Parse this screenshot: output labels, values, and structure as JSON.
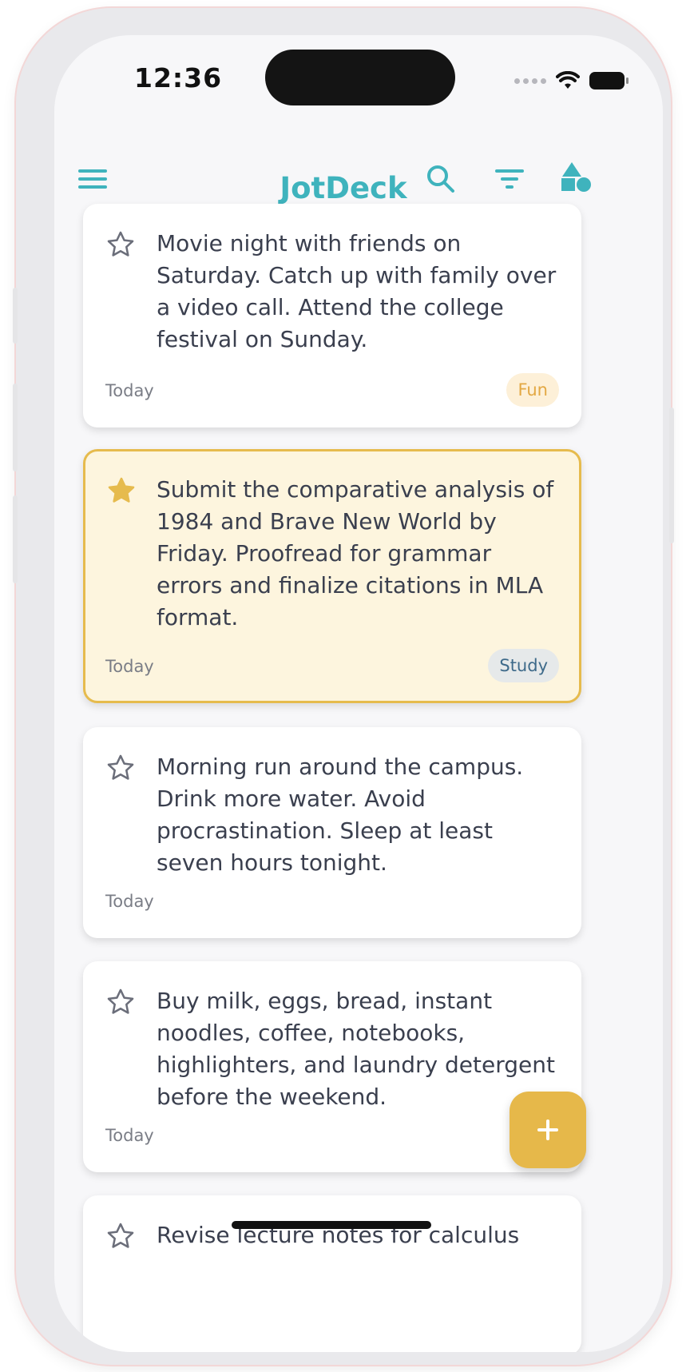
{
  "status_bar": {
    "time": "12:36"
  },
  "app": {
    "title": "JotDeck"
  },
  "notes": [
    {
      "text": "Movie night with friends on Saturday. Catch up with family over a video call. Attend the college festival on Sunday.",
      "date": "Today",
      "tag": "Fun",
      "starred": false
    },
    {
      "text": "Submit the comparative analysis of 1984 and Brave New World by Friday. Proofread for grammar errors and finalize citations in MLA format.",
      "date": "Today",
      "tag": "Study",
      "starred": true
    },
    {
      "text": "Morning run around the campus. Drink more water. Avoid procrastination. Sleep at least seven hours tonight.",
      "date": "Today",
      "tag": "",
      "starred": false
    },
    {
      "text": "Buy milk, eggs, bread, instant noodles, coffee, notebooks, highlighters, and laundry detergent before the weekend.",
      "date": "Today",
      "tag": "",
      "starred": false
    },
    {
      "text": "Revise lecture notes for calculus",
      "date": "",
      "tag": "",
      "starred": false
    }
  ],
  "fab": {
    "label": "+"
  },
  "colors": {
    "accent": "#3fb3bd",
    "favorite": "#e6bb4d",
    "fab": "#e6b84a"
  }
}
